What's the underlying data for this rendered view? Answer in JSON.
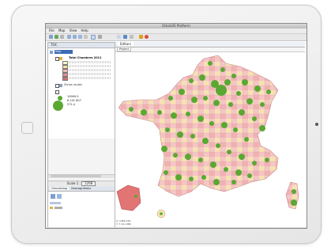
{
  "window": {
    "title": "OrbisGIS Platform"
  },
  "menu": [
    "File",
    "Map",
    "View",
    "Help"
  ],
  "toc": {
    "tab_label": "TOC",
    "root_label": "Map",
    "legend_title": "Total Chambres 2011",
    "legend_rows": [
      {
        "color": "#fdf6c3"
      },
      {
        "color": "#f9e1a4"
      },
      {
        "color": "#f4b8b8"
      },
      {
        "color": "#e98c8c"
      },
      {
        "color": "#d46d6d"
      }
    ],
    "layer2_label": "Zones routes",
    "proportional": [
      "19999.5",
      "6 101 807",
      "271.4"
    ]
  },
  "scale": {
    "label": "Scale 1 :",
    "value": "2268"
  },
  "lower_tabs": [
    "Geocatalog",
    "Geocognitions"
  ],
  "map": {
    "tab_label": "Editors",
    "subtab_label": "Project",
    "dot_color": "#5aa832",
    "land_colors": [
      "#f4c6c6",
      "#f6e2b2",
      "#f1b1b1"
    ],
    "coordinates": [
      "X: 1465 234",
      "Y: 7 211 980"
    ]
  }
}
